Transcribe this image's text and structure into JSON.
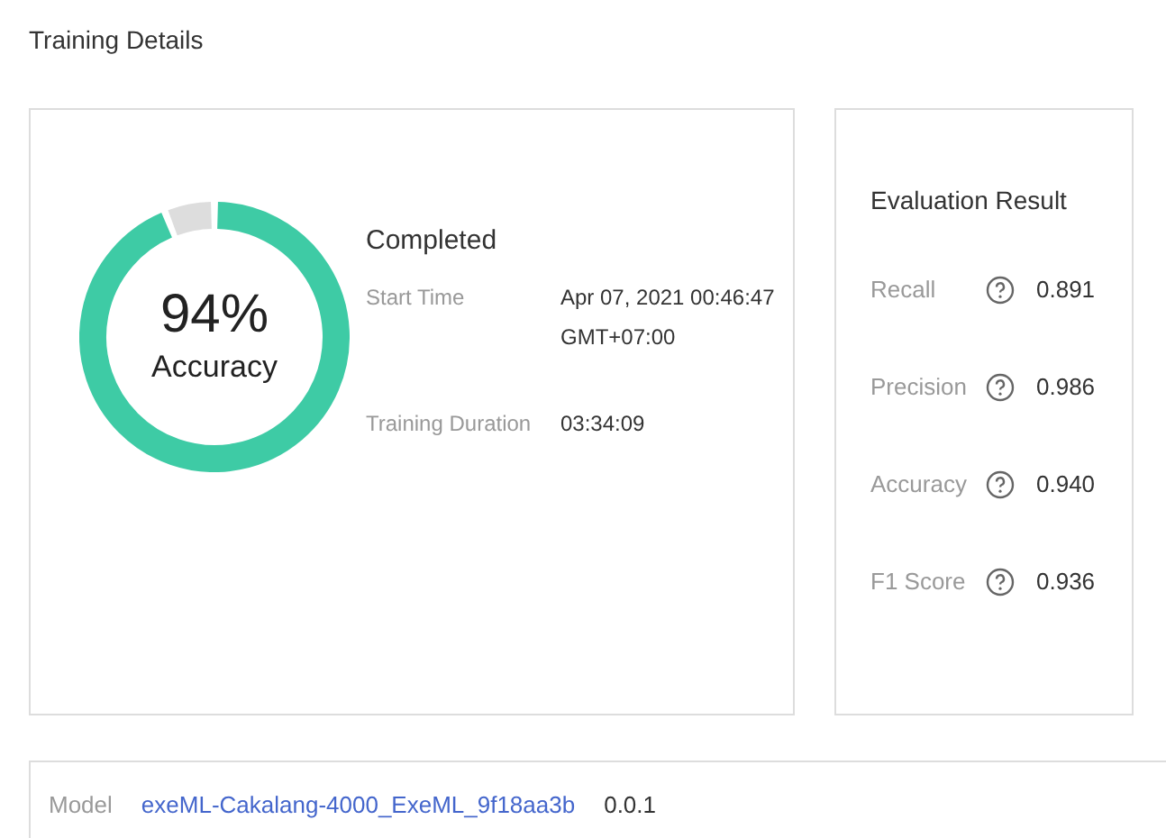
{
  "title": "Training Details",
  "accuracy_ring": {
    "value": "94%",
    "label": "Accuracy"
  },
  "status": "Completed",
  "details": [
    {
      "label": "Start Time",
      "value": "Apr 07, 2021 00:46:47 GMT+07:00"
    },
    {
      "label": "Training Duration",
      "value": "03:34:09"
    }
  ],
  "evaluation": {
    "title": "Evaluation Result",
    "metrics": [
      {
        "name": "Recall",
        "value": "0.891"
      },
      {
        "name": "Precision",
        "value": "0.986"
      },
      {
        "name": "Accuracy",
        "value": "0.940"
      },
      {
        "name": "F1 Score",
        "value": "0.936"
      }
    ]
  },
  "model": {
    "label": "Model",
    "name": "exeML-Cakalang-4000_ExeML_9f18aa3b",
    "version": "0.0.1"
  }
}
